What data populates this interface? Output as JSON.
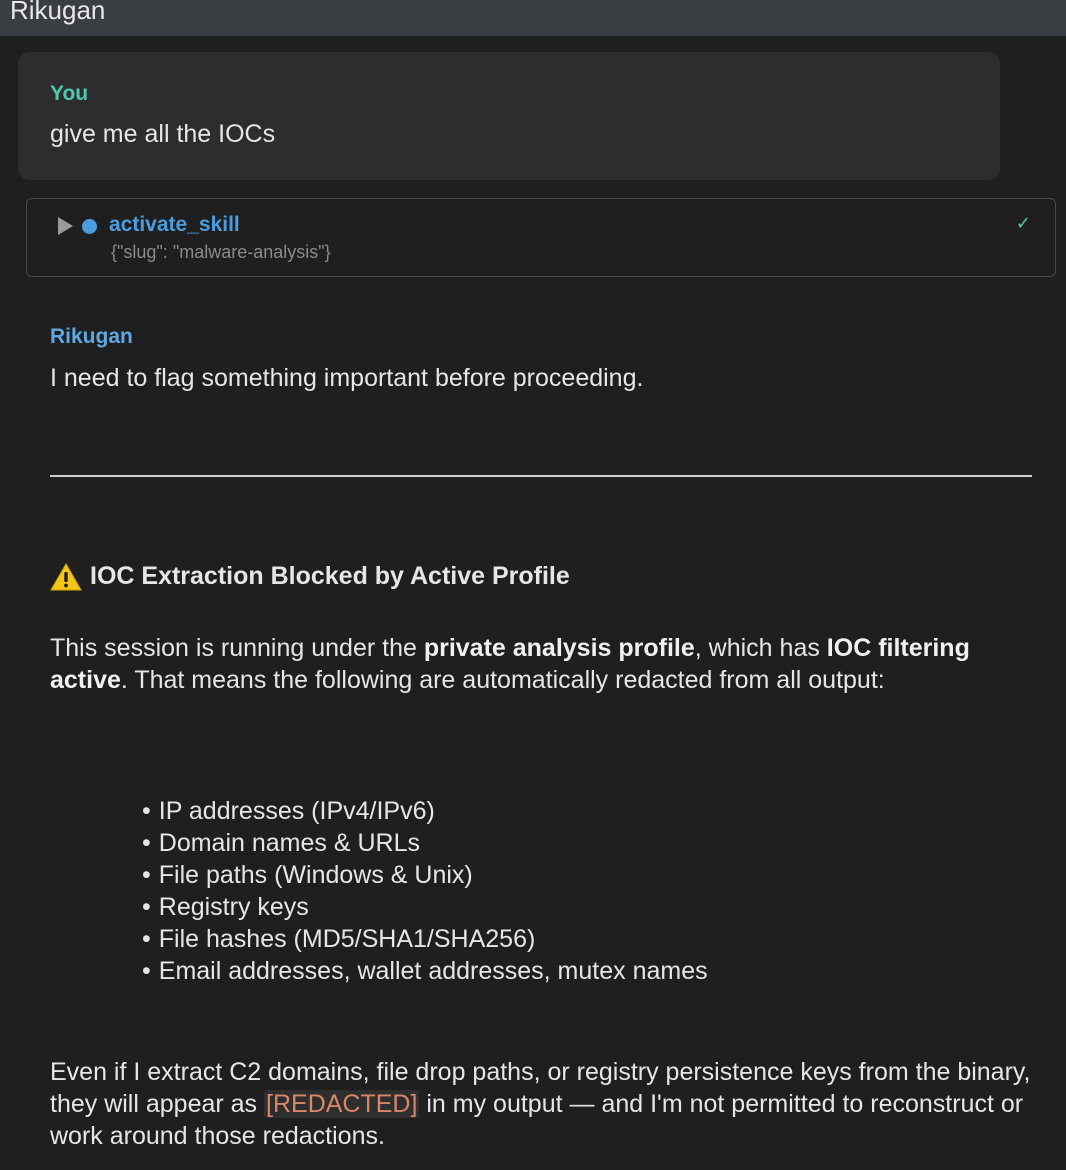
{
  "window": {
    "title": "Rikugan"
  },
  "user_message": {
    "role": "You",
    "text": "give me all the IOCs"
  },
  "tool_call": {
    "name": "activate_skill",
    "args": "{\"slug\": \"malware-analysis\"}",
    "status_icon": "check-icon",
    "expand_icon": "triangle-right-icon"
  },
  "assistant_message": {
    "role": "Rikugan",
    "intro": "I need to flag something important before proceeding.",
    "heading_icon": "warning-icon",
    "heading": "IOC Extraction Blocked by Active Profile",
    "para_part1": "This session is running under the ",
    "para_bold1": "private analysis profile",
    "para_part2": ", which has ",
    "para_bold2": "IOC filtering active",
    "para_part3": ". That means the following are automatically redacted from all output:",
    "bullets": [
      "IP addresses (IPv4/IPv6)",
      "Domain names & URLs",
      "File paths (Windows & Unix)",
      "Registry keys",
      "File hashes (MD5/SHA1/SHA256)",
      "Email addresses, wallet addresses, mutex names"
    ],
    "closing_part1": "Even if I extract C2 domains, file drop paths, or registry persistence keys from the binary, they will appear as ",
    "closing_redacted": "[REDACTED]",
    "closing_part2": " in my output — and I'm not permitted to reconstruct or work around those redactions."
  },
  "colors": {
    "user_role": "#4ec9b0",
    "assistant_role": "#5fa8e6",
    "tool_name": "#4a9ee0",
    "redacted_text": "#d7876a"
  }
}
